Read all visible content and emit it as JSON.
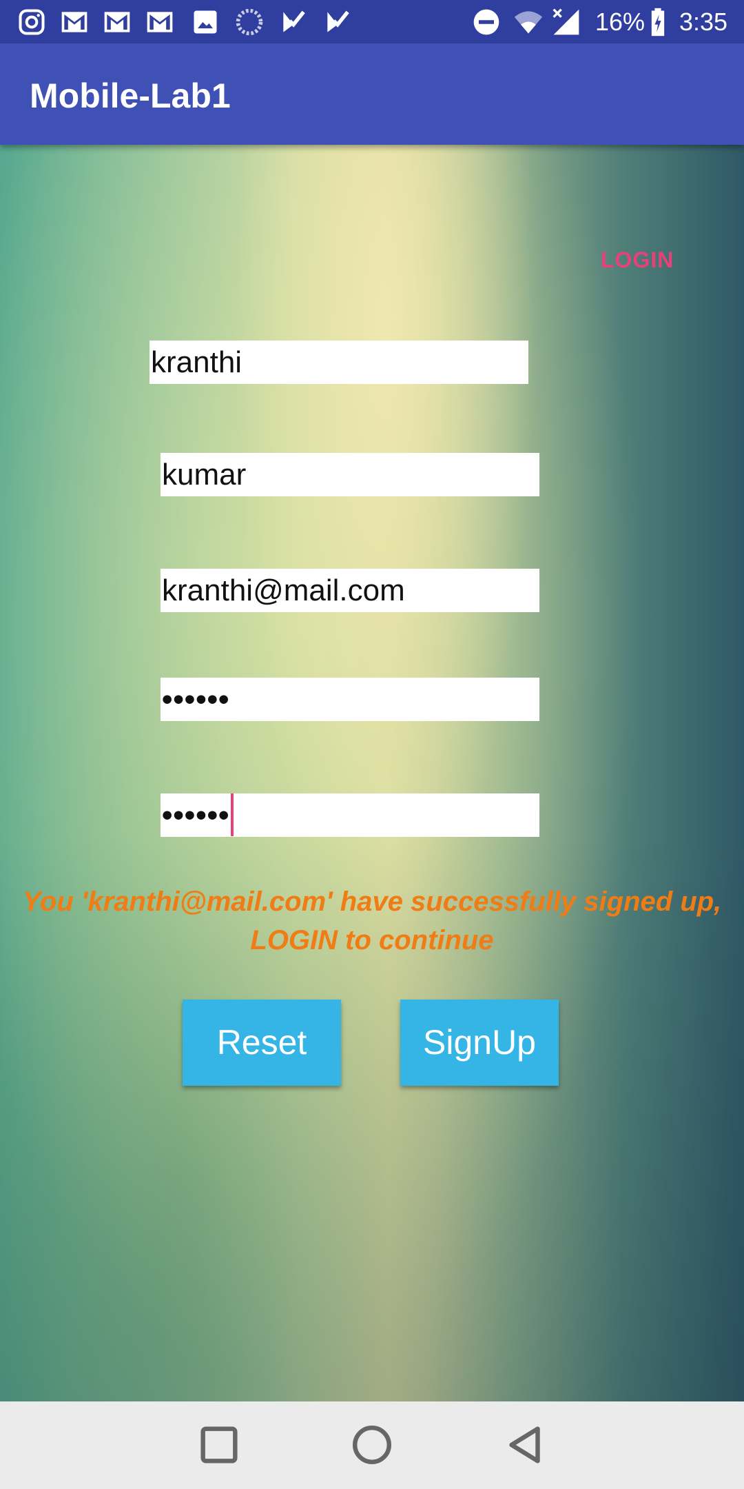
{
  "status_bar": {
    "battery": "16%",
    "time": "3:35",
    "icons": [
      "instagram-icon",
      "gmail-icon",
      "gmail-icon",
      "gmail-icon",
      "image-icon",
      "sync-icon",
      "task-check-icon",
      "task-check-icon",
      "do-not-disturb-icon",
      "wifi-icon",
      "signal-icon",
      "battery-charging-icon"
    ]
  },
  "app_bar": {
    "title": "Mobile-Lab1"
  },
  "form": {
    "login_link": "LOGIN",
    "first_name": "kranthi",
    "last_name": "kumar",
    "email": "kranthi@mail.com",
    "password": "••••••",
    "confirm_password": "••••••",
    "message": "You 'kranthi@mail.com' have successfully signed up, LOGIN to continue",
    "reset_label": "Reset",
    "signup_label": "SignUp"
  },
  "nav_bar": {
    "icons": [
      "recents-square-icon",
      "home-circle-icon",
      "back-triangle-icon"
    ]
  },
  "colors": {
    "status_bar": "#303f9f",
    "app_bar": "#3f51b5",
    "accent": "#e9407a",
    "message": "#ef7c14",
    "button": "#35b5e5"
  }
}
